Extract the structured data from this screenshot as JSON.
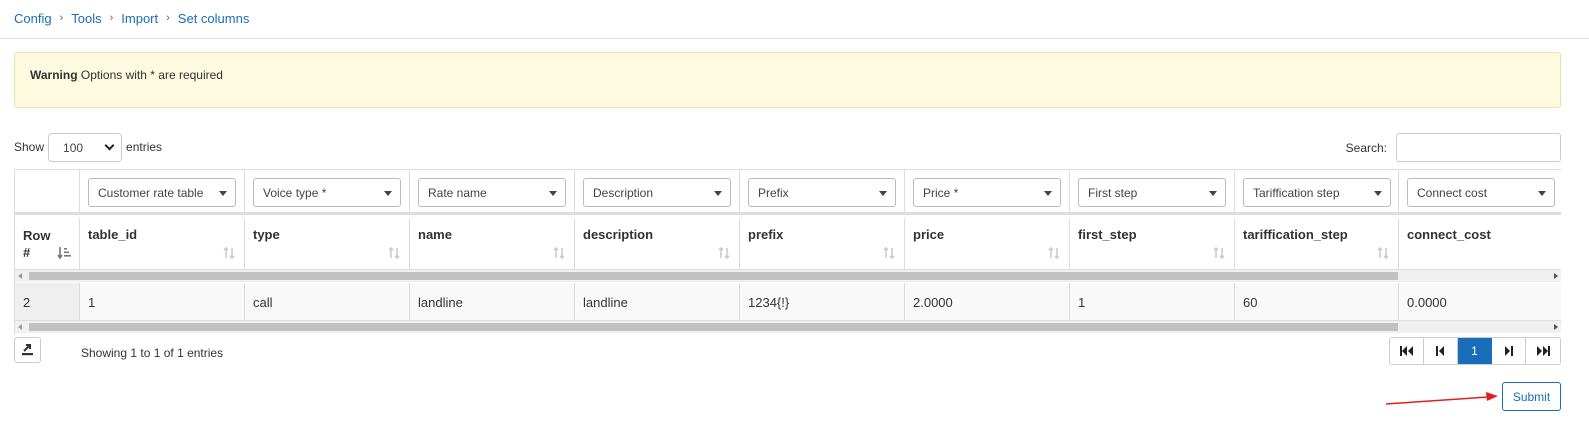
{
  "breadcrumb": [
    "Config",
    "Tools",
    "Import",
    "Set columns"
  ],
  "alert": {
    "title": "Warning",
    "text": "Options with * are required"
  },
  "length": {
    "prefix": "Show",
    "value": "100",
    "suffix": "entries"
  },
  "search": {
    "label": "Search:",
    "value": ""
  },
  "column_selects": [
    "Customer rate table",
    "Voice type *",
    "Rate name",
    "Description",
    "Prefix",
    "Price *",
    "First step",
    "Tariffication step",
    "Connect cost"
  ],
  "headers": [
    "Row #",
    "table_id",
    "type",
    "name",
    "description",
    "prefix",
    "price",
    "first_step",
    "tariffication_step",
    "connect_cost"
  ],
  "row": [
    "2",
    "1",
    "call",
    "landline",
    "landline",
    "1234{!}",
    "2.0000",
    "1",
    "60",
    "0.0000"
  ],
  "info": "Showing 1 to 1 of 1 entries",
  "pagination": {
    "current": "1"
  },
  "submit_label": "Submit",
  "colors": {
    "link": "#1a6eb9",
    "alert_bg": "#fcfbdf",
    "annotation_arrow": "#e02020"
  }
}
